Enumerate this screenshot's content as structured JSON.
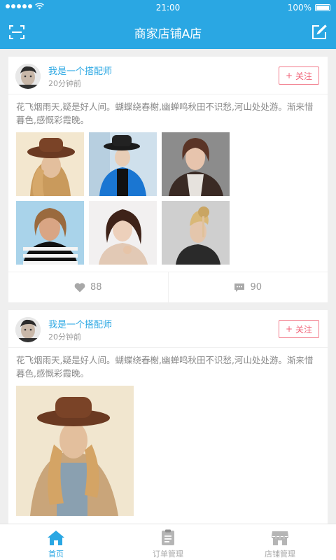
{
  "statusbar": {
    "time": "21:00",
    "battery": "100%"
  },
  "navbar": {
    "title": "商家店铺A店"
  },
  "posts": [
    {
      "user": "我是一个搭配师",
      "time": "20分钟前",
      "follow_label": "关注",
      "text": "花飞烟雨天,疑是好人间。蝴蝶绕春榭,幽蝉鸣秋田不识愁,河山处处游。渐来惜暮色,感慨彩霞晚。",
      "likes": "88",
      "comments": "90"
    },
    {
      "user": "我是一个搭配师",
      "time": "20分钟前",
      "follow_label": "关注",
      "text": "花飞烟雨天,疑是好人间。蝴蝶绕春榭,幽蝉鸣秋田不识愁,河山处处游。渐来惜暮色,感慨彩霞晚。"
    }
  ],
  "tabs": [
    {
      "label": "首页",
      "icon": "home-icon",
      "active": true
    },
    {
      "label": "订单管理",
      "icon": "clipboard-icon",
      "active": false
    },
    {
      "label": "店铺管理",
      "icon": "store-icon",
      "active": false
    }
  ],
  "colors": {
    "primary": "#2aa7e3",
    "follow": "#f06277"
  }
}
